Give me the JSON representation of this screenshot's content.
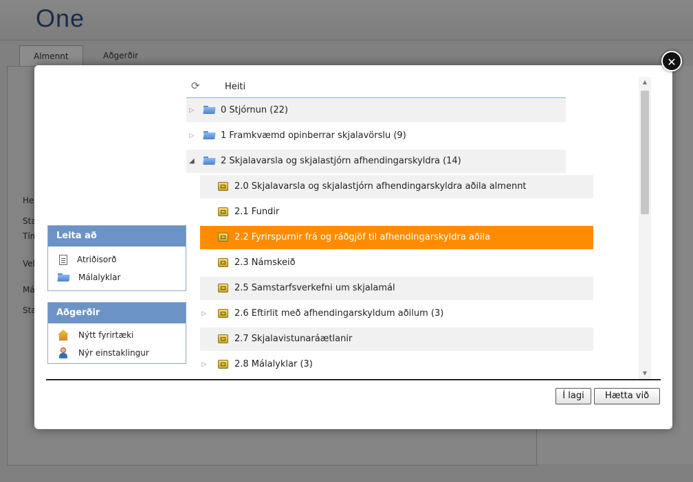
{
  "app": {
    "logo": "One",
    "tabs": [
      "Almennt",
      "Aðgerðir"
    ],
    "side_labels": [
      "Heit",
      "Stað",
      "Tím",
      "Vel",
      "Mál",
      "Sta"
    ]
  },
  "dialog": {
    "close_symbol": "✕",
    "search_panel": {
      "title": "Leita að",
      "items": [
        {
          "label": "Atriðisorð",
          "icon": "document-icon"
        },
        {
          "label": "Málalyklar",
          "icon": "folder-icon"
        }
      ]
    },
    "actions_panel": {
      "title": "Aðgerðir",
      "items": [
        {
          "label": "Nýtt fyrirtæki",
          "icon": "house-icon"
        },
        {
          "label": "Nýr einstaklingur",
          "icon": "person-icon"
        }
      ]
    },
    "tree": {
      "column_title": "Heiti",
      "rows": [
        {
          "label": "0 Stjórnun (22)",
          "level": 0,
          "expander": "collapsed",
          "icon": "folder-icon",
          "selected": false
        },
        {
          "label": "1 Framkvæmd opinberrar skjalavörslu (9)",
          "level": 0,
          "expander": "collapsed",
          "icon": "folder-icon",
          "selected": false
        },
        {
          "label": "2 Skjalavarsla og skjalastjórn afhendingarskyldra (14)",
          "level": 0,
          "expander": "expanded",
          "icon": "folder-icon",
          "selected": false
        },
        {
          "label": "2.0 Skjalavarsla og skjalastjórn afhendingarskyldra aðila almennt",
          "level": 1,
          "expander": "none",
          "icon": "case-icon",
          "selected": false
        },
        {
          "label": "2.1 Fundir",
          "level": 1,
          "expander": "none",
          "icon": "case-icon",
          "selected": false
        },
        {
          "label": "2.2 Fyrirspurnir frá og ráðgjöf til afhendingarskyldra aðila",
          "level": 1,
          "expander": "none",
          "icon": "case-icon",
          "selected": true
        },
        {
          "label": "2.3 Námskeið",
          "level": 1,
          "expander": "none",
          "icon": "case-icon",
          "selected": false
        },
        {
          "label": "2.5 Samstarfsverkefni um skjalamál",
          "level": 1,
          "expander": "none",
          "icon": "case-icon",
          "selected": false
        },
        {
          "label": "2.6 Eftirlit með afhendingarskyldum aðilum (3)",
          "level": 1,
          "expander": "collapsed",
          "icon": "case-icon",
          "selected": false
        },
        {
          "label": "2.7 Skjalavistunaráætlanir",
          "level": 1,
          "expander": "none",
          "icon": "case-icon",
          "selected": false
        },
        {
          "label": "2.8 Málalyklar (3)",
          "level": 1,
          "expander": "collapsed",
          "icon": "case-icon",
          "selected": false
        }
      ]
    },
    "buttons": {
      "ok": "Í lagi",
      "cancel": "Hætta við"
    }
  },
  "colors": {
    "selection": "#ff8c00",
    "panel_header": "#6b93c6",
    "brand": "#2d4f7c"
  }
}
